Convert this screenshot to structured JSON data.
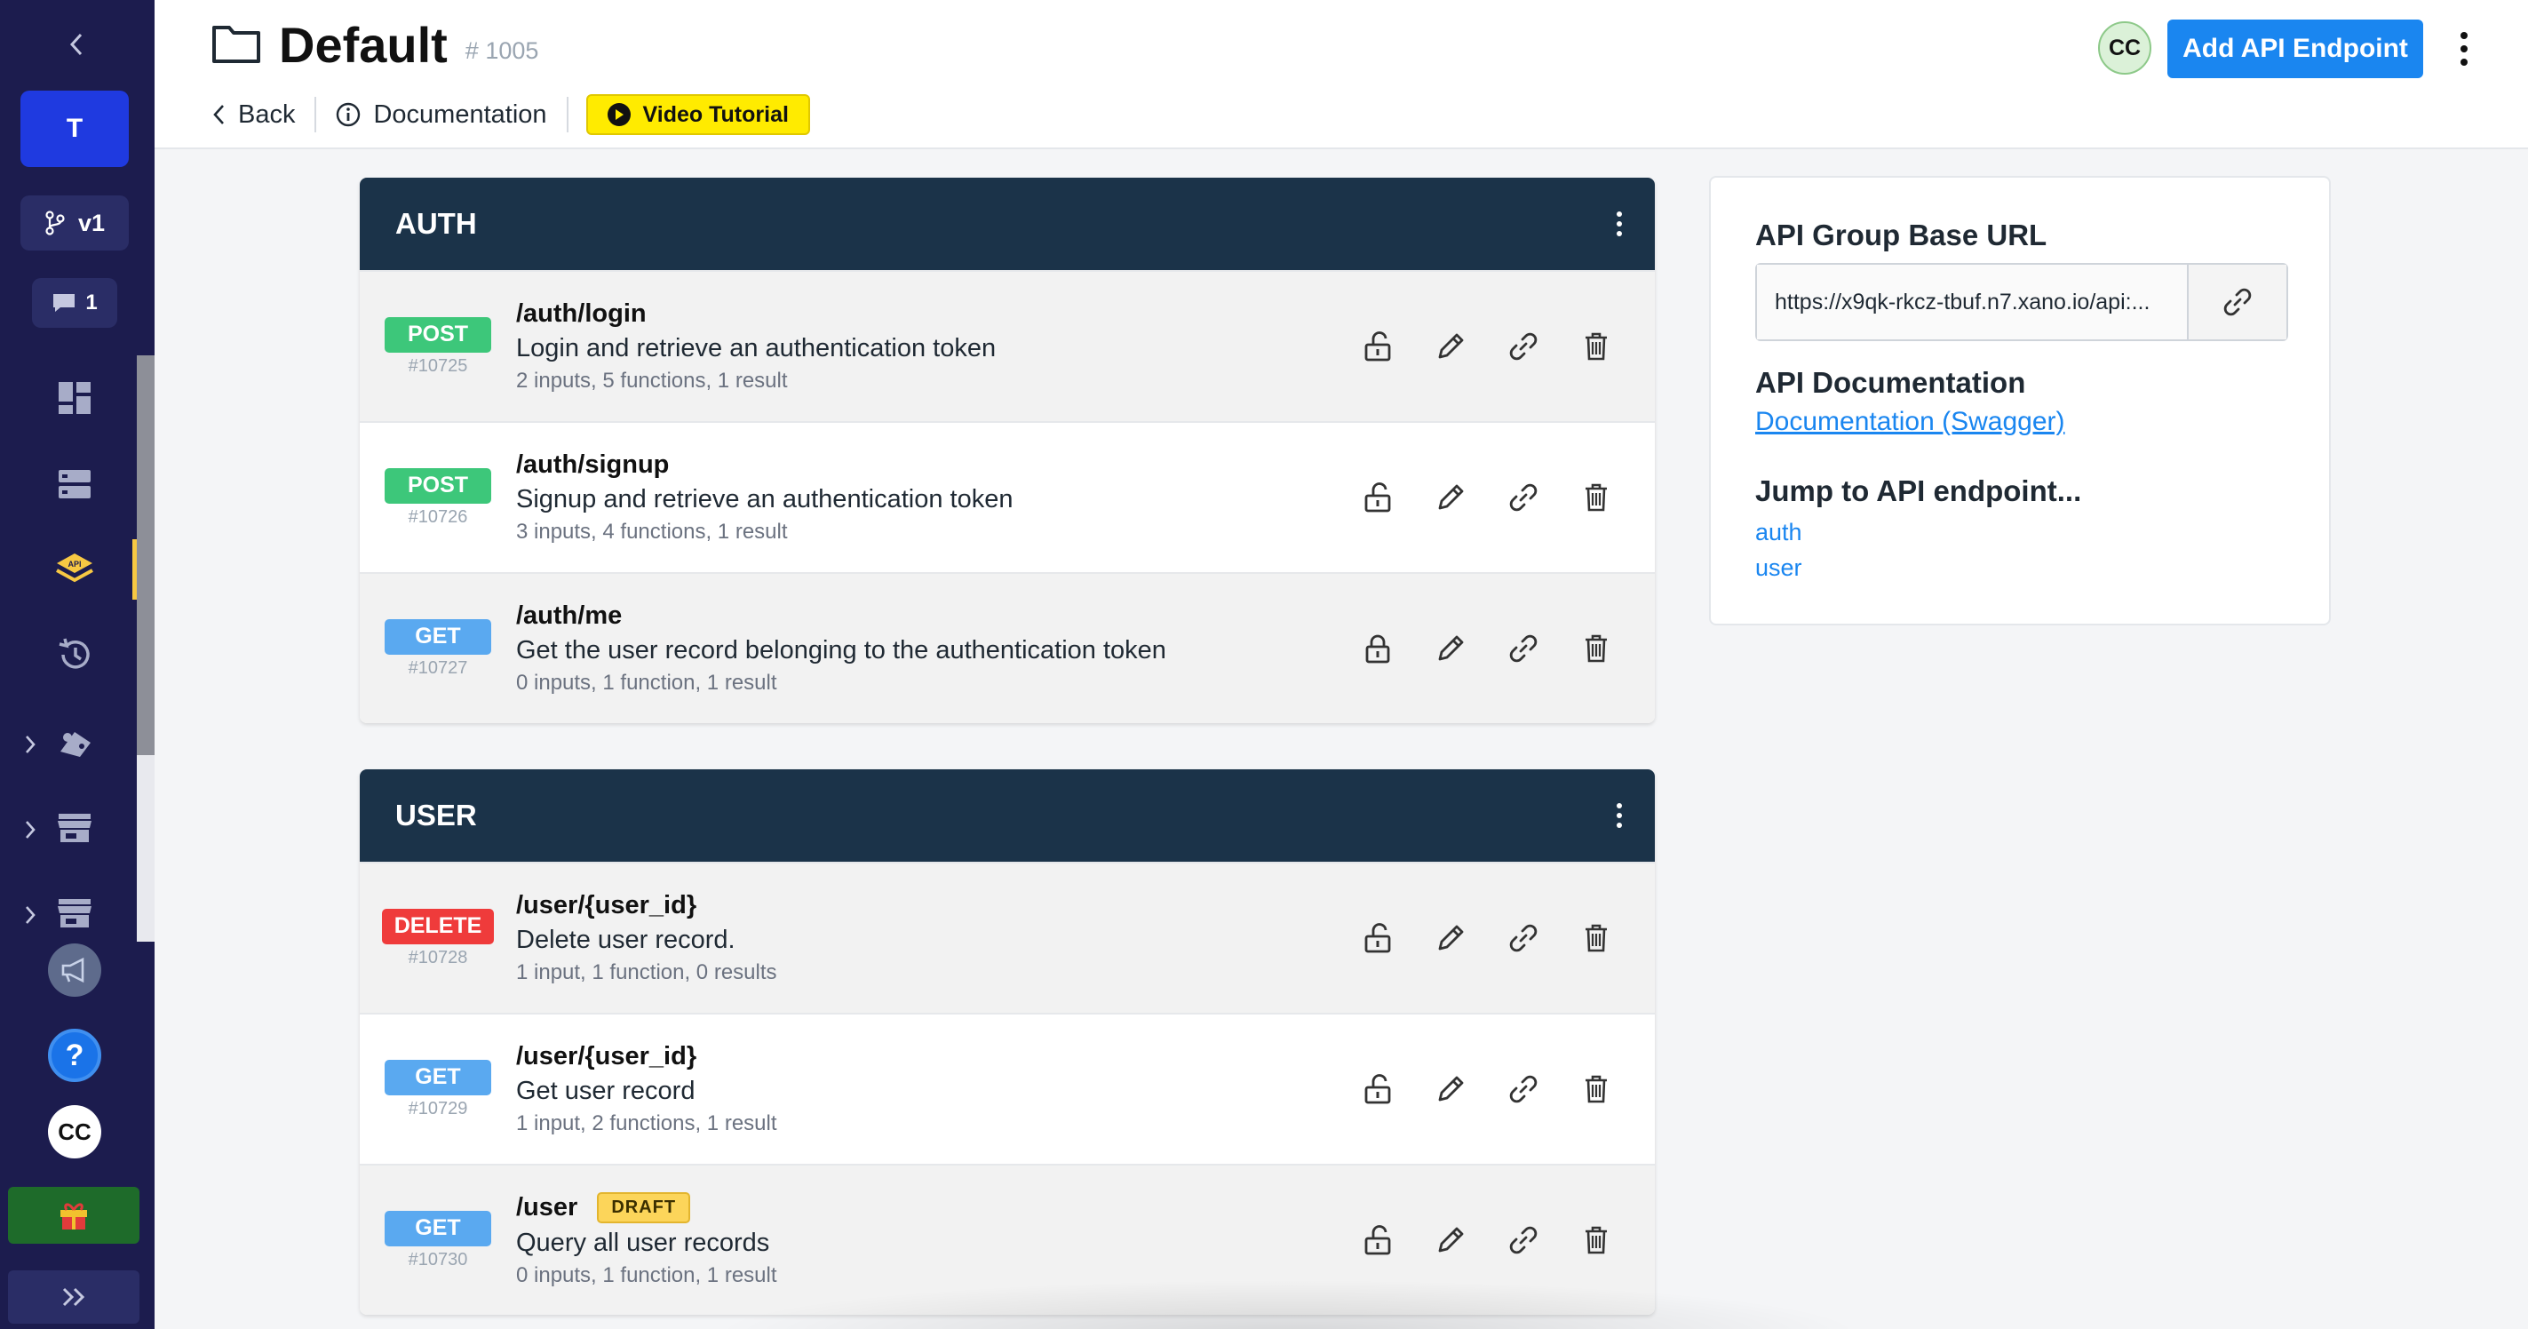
{
  "sidebar": {
    "team_initial": "T",
    "branch": "v1",
    "comment_count": "1",
    "avatar_initials": "CC",
    "help_glyph": "?",
    "nav_icons": [
      "dashboard-icon",
      "database-icon",
      "api-icon",
      "history-icon",
      "addons-icon",
      "marketplace-icon",
      "store-icon"
    ],
    "accent_active": "#f7c843"
  },
  "header": {
    "title": "Default",
    "id": "# 1005",
    "back_label": "Back",
    "docs_label": "Documentation",
    "video_label": "Video Tutorial",
    "avatar_initials": "CC",
    "add_button_label": "Add API Endpoint"
  },
  "groups": [
    {
      "name": "AUTH",
      "endpoints": [
        {
          "method": "POST",
          "id": "#10725",
          "path": "/auth/login",
          "description": "Login and retrieve an authentication token",
          "meta": "2 inputs, 5 functions, 1 result",
          "locked": false
        },
        {
          "method": "POST",
          "id": "#10726",
          "path": "/auth/signup",
          "description": "Signup and retrieve an authentication token",
          "meta": "3 inputs, 4 functions, 1 result",
          "locked": false
        },
        {
          "method": "GET",
          "id": "#10727",
          "path": "/auth/me",
          "description": "Get the user record belonging to the authentication token",
          "meta": "0 inputs, 1 function, 1 result",
          "locked": true
        }
      ]
    },
    {
      "name": "USER",
      "endpoints": [
        {
          "method": "DELETE",
          "id": "#10728",
          "path": "/user/{user_id}",
          "description": "Delete user record.",
          "meta": "1 input, 1 function, 0 results",
          "locked": false
        },
        {
          "method": "GET",
          "id": "#10729",
          "path": "/user/{user_id}",
          "description": "Get user record",
          "meta": "1 input, 2 functions, 1 result",
          "locked": false
        },
        {
          "method": "GET",
          "id": "#10730",
          "path": "/user",
          "badge": "DRAFT",
          "description": "Query all user records",
          "meta": "0 inputs, 1 function, 1 result",
          "locked": false
        }
      ]
    }
  ],
  "info": {
    "base_url_title": "API Group Base URL",
    "base_url": "https://x9qk-rkcz-tbuf.n7.xano.io/api:...",
    "docs_title": "API Documentation",
    "docs_link": "Documentation (Swagger)",
    "jump_title": "Jump to API endpoint...",
    "jump_links": [
      "auth",
      "user"
    ]
  },
  "colors": {
    "post": "#3dc77a",
    "get": "#5aa9f0",
    "delete": "#ef3b3b",
    "primary": "#1a86f0",
    "group_header": "#1b3349"
  }
}
